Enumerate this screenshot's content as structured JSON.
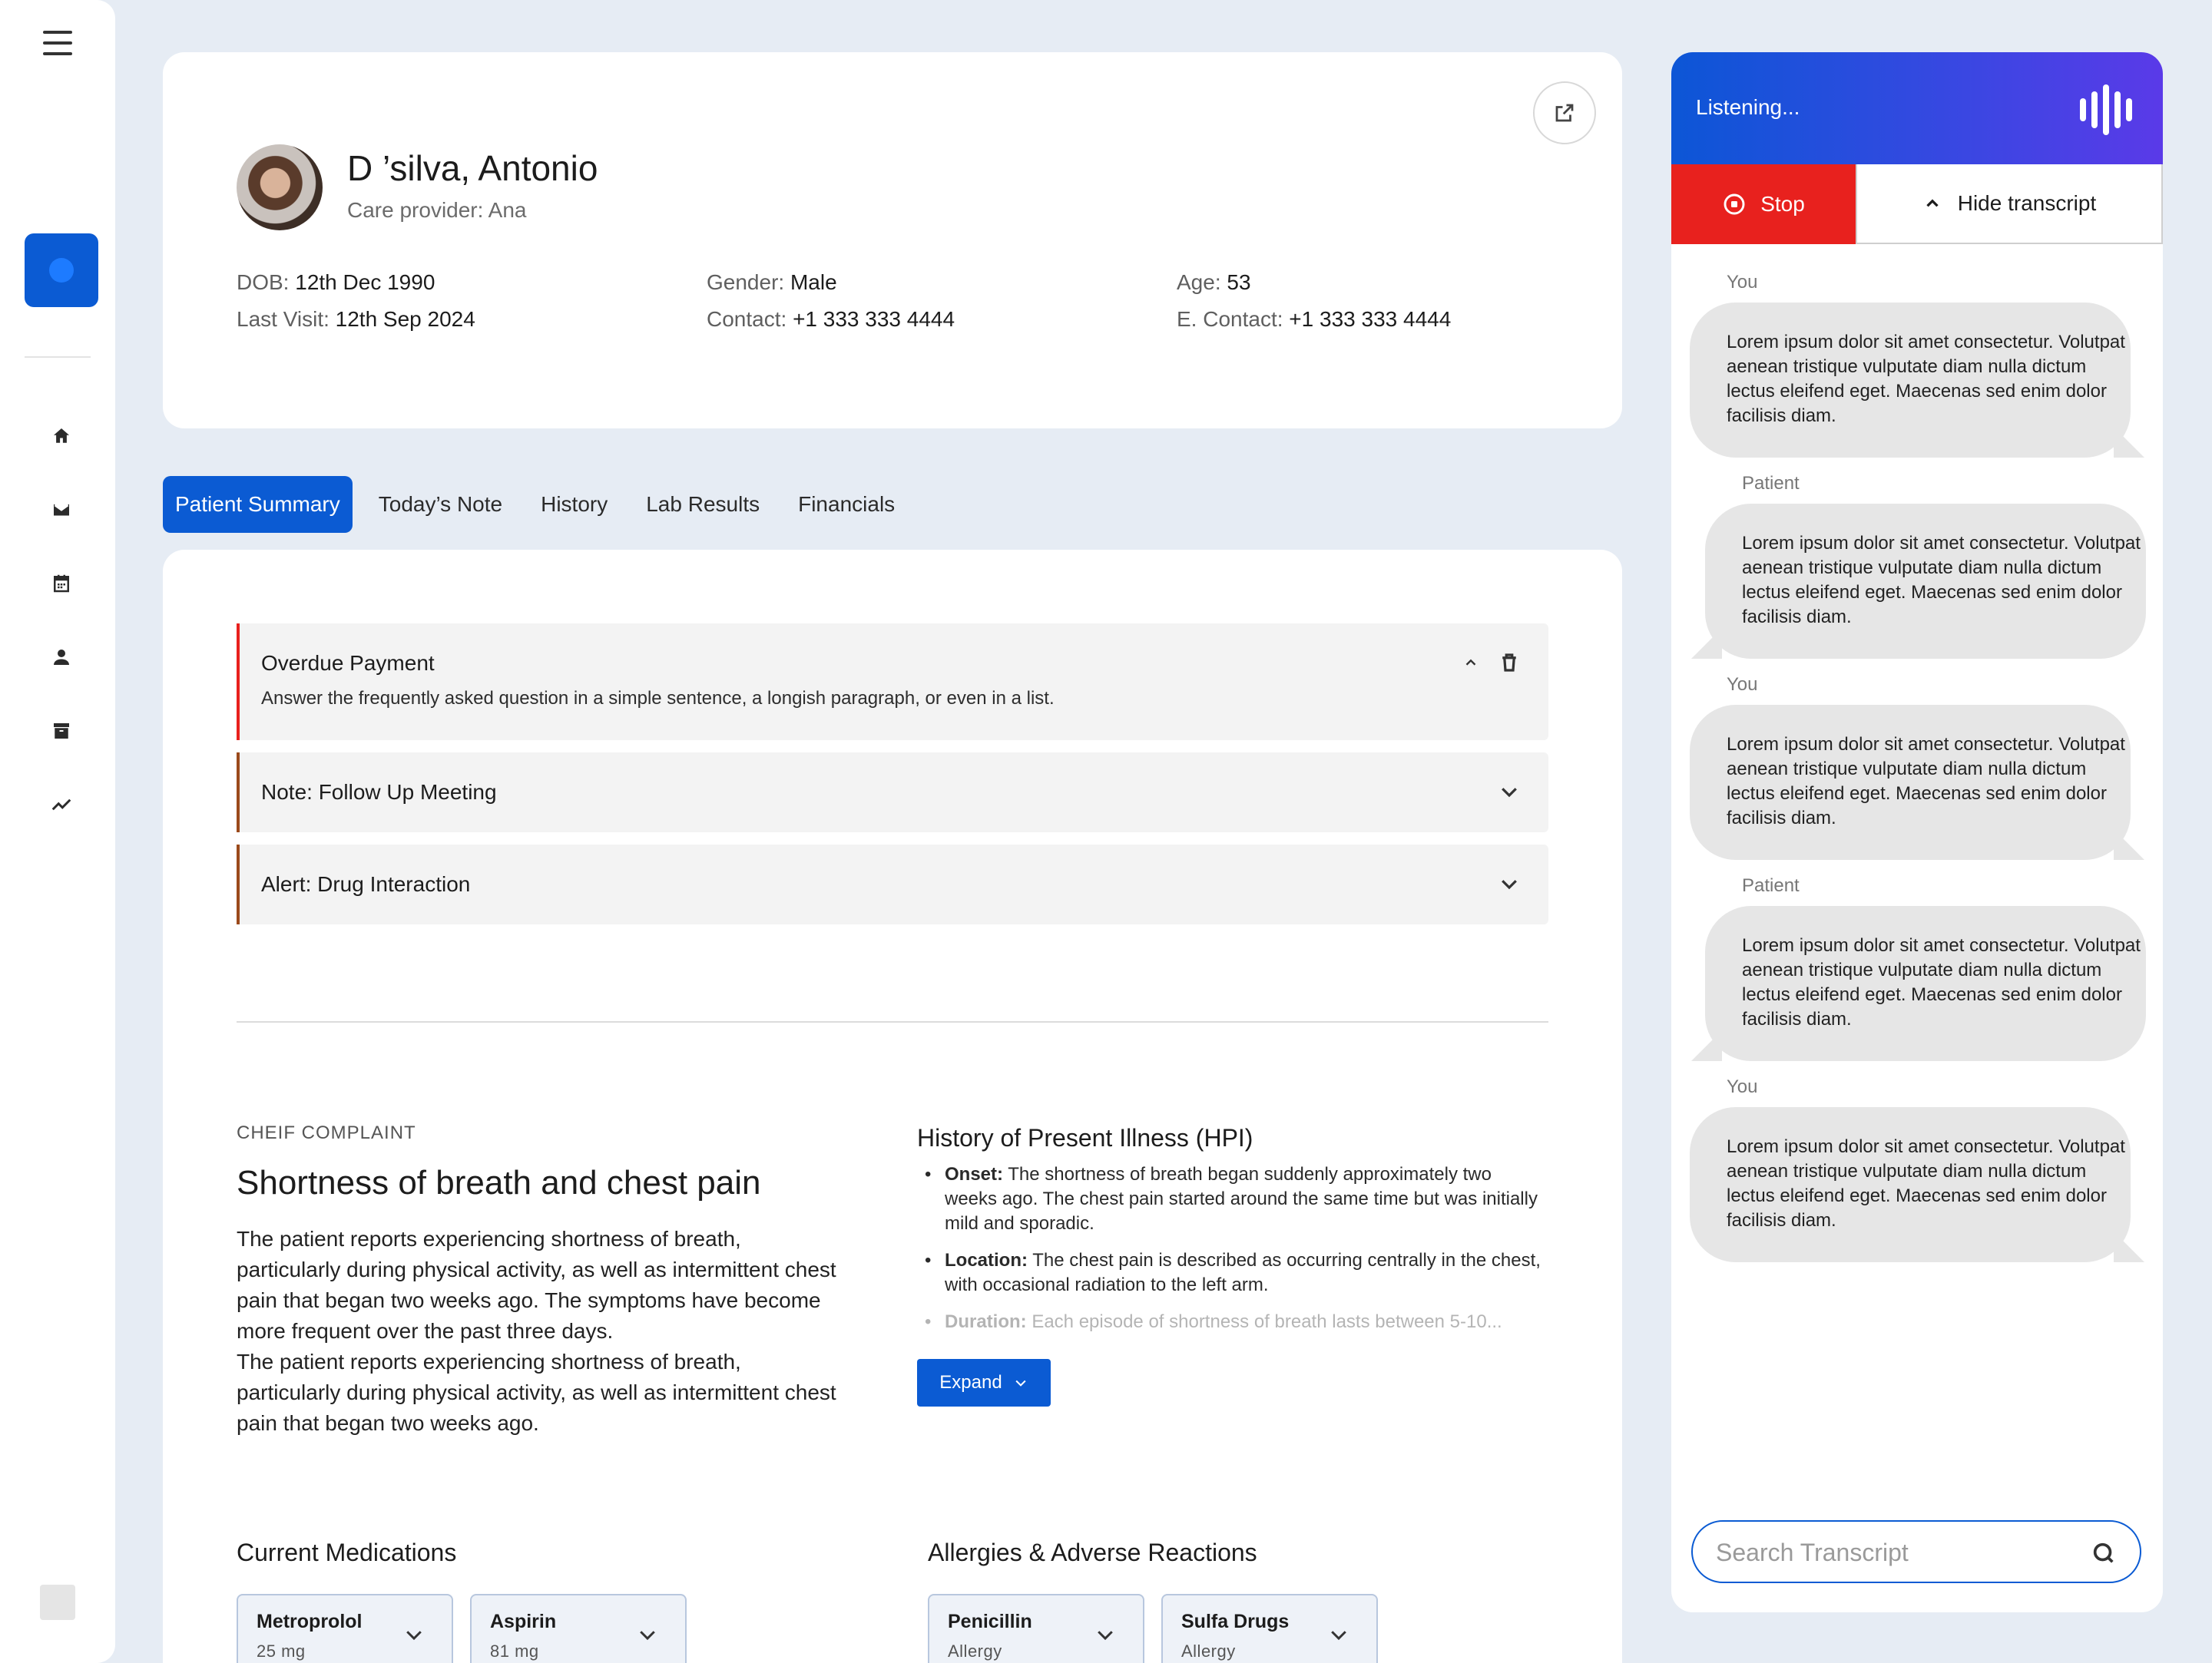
{
  "patient": {
    "name": "D ’silva, Antonio",
    "provider": "Care provider: Ana",
    "dob_label": "DOB:",
    "dob": "12th Dec 1990",
    "last_visit_label": "Last Visit:",
    "last_visit": "12th Sep 2024",
    "gender_label": "Gender:",
    "gender": "Male",
    "contact_label": "Contact:",
    "contact": "+1 333 333 4444",
    "age_label": "Age:",
    "age": "53",
    "econtact_label": "E. Contact:",
    "econtact": "+1 333 333 4444"
  },
  "tabs": [
    "Patient Summary",
    "Today’s Note",
    "History",
    "Lab Results",
    "Financials"
  ],
  "accordions": [
    {
      "title": "Overdue Payment",
      "body": "Answer the frequently asked question in a simple sentence, a longish paragraph, or even in a list.",
      "expanded": true,
      "accent": "#e8211e"
    },
    {
      "title": "Note: Follow Up Meeting",
      "expanded": false,
      "accent": "#9b4a1c"
    },
    {
      "title": "Alert: Drug Interaction",
      "expanded": false,
      "accent": "#9b4a1c"
    }
  ],
  "chief_complaint": {
    "label": "CHEIF COMPLAINT",
    "title": "Shortness of breath and chest pain",
    "text1": "The patient reports experiencing shortness of breath, particularly during physical activity, as well as intermittent chest pain that began two weeks ago. The symptoms have become more frequent over the past three days.",
    "text2": "The patient reports experiencing shortness of breath, particularly during physical activity, as well as intermittent chest pain that began two weeks ago."
  },
  "hpi": {
    "title": "History of Present Illness (HPI)",
    "items": [
      {
        "label": "Onset:",
        "text": "The shortness of breath began suddenly approximately two weeks ago. The chest pain started around the same time but was initially mild and sporadic."
      },
      {
        "label": "Location:",
        "text": "The chest pain is described as occurring centrally in the chest, with occasional radiation to the left arm."
      },
      {
        "label": "Duration:",
        "text": "Each episode of shortness of breath lasts between 5-10..."
      }
    ],
    "expand_label": "Expand"
  },
  "medications": {
    "title": "Current Medications",
    "items": [
      {
        "name": "Metroprolol",
        "sub": "25 mg"
      },
      {
        "name": "Aspirin",
        "sub": "81 mg"
      }
    ]
  },
  "allergies": {
    "title": "Allergies & Adverse Reactions",
    "items": [
      {
        "name": "Penicillin",
        "sub": "Allergy"
      },
      {
        "name": "Sulfa Drugs",
        "sub": "Allergy"
      }
    ]
  },
  "transcript": {
    "status": "Listening...",
    "stop_label": "Stop",
    "hide_label": "Hide transcript",
    "messages": [
      {
        "speaker": "You",
        "text": "Lorem ipsum dolor sit amet consectetur. Volutpat aenean tristique vulputate diam nulla dictum lectus eleifend eget. Maecenas sed enim dolor facilisis diam."
      },
      {
        "speaker": "Patient",
        "text": "Lorem ipsum dolor sit amet consectetur. Volutpat aenean tristique vulputate diam nulla dictum lectus eleifend eget. Maecenas sed enim dolor facilisis diam."
      },
      {
        "speaker": "You",
        "text": "Lorem ipsum dolor sit amet consectetur. Volutpat aenean tristique vulputate diam nulla dictum lectus eleifend eget. Maecenas sed enim dolor facilisis diam."
      },
      {
        "speaker": "Patient",
        "text": "Lorem ipsum dolor sit amet consectetur. Volutpat aenean tristique vulputate diam nulla dictum lectus eleifend eget. Maecenas sed enim dolor facilisis diam."
      },
      {
        "speaker": "You",
        "text": "Lorem ipsum dolor sit amet consectetur. Volutpat aenean tristique vulputate diam nulla dictum lectus eleifend eget. Maecenas sed enim dolor facilisis diam."
      }
    ],
    "search_placeholder": "Search Transcript"
  },
  "icons": {
    "sidebar": [
      "menu-icon",
      "home-icon",
      "mail-icon",
      "calendar-icon",
      "person-icon",
      "archive-icon",
      "trend-icon"
    ],
    "accent": "#0b5bd3"
  }
}
